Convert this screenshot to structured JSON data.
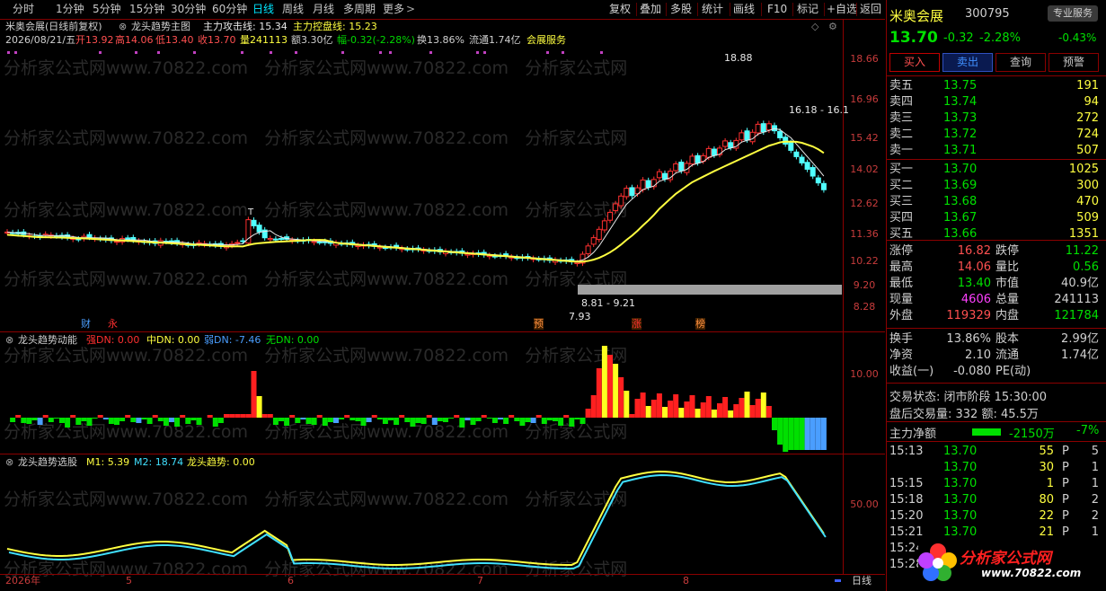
{
  "toolbar": {
    "periods": [
      "分时",
      "1分钟",
      "5分钟",
      "15分钟",
      "30分钟",
      "60分钟",
      "日线",
      "周线",
      "月线",
      "多周期",
      "更多"
    ],
    "right": [
      "复权",
      "叠加",
      "多股",
      "统计",
      "画线",
      "F10",
      "标记",
      "+自选",
      "返回"
    ]
  },
  "main": {
    "stock_line": "米奥会展(日线前复权)",
    "indicator_name": "龙头趋势主图",
    "attack_label": "主力攻击线: 15.34",
    "control_label": "主力控盘线: 15.23",
    "date": "2026/08/21/五",
    "open": "开13.92",
    "high": "高14.06",
    "low": "低13.40",
    "close": "收13.70",
    "vol": "量241113",
    "amount": "额3.30亿",
    "change": "幅-0.32(-2.28%)",
    "turnover": "换13.86%",
    "float": "流通1.74亿",
    "sector": "会展服务",
    "axis": [
      "18.66",
      "16.96",
      "15.42",
      "14.02",
      "12.62",
      "11.36",
      "10.22",
      "9.20",
      "8.28"
    ],
    "ann_high": "18.88",
    "ann_right": "16.18 - 16.1",
    "ann_low": "7.93",
    "ann_range": "8.81 - 9.21",
    "ann_t": "T",
    "markers": [
      "财",
      "永",
      "预",
      "涨",
      "榜"
    ]
  },
  "momentum": {
    "title": "龙头趋势动能",
    "strong": "强DN: 0.00",
    "mid": "中DN: 0.00",
    "weak": "弱DN: -7.46",
    "none": "无DN: 0.00",
    "axis": "10.00"
  },
  "selector": {
    "title": "龙头趋势选股",
    "m1": "M1: 5.39",
    "m2": "M2: 18.74",
    "trend": "龙头趋势: 0.00",
    "axis": "50.00"
  },
  "xaxis": {
    "year": "2026年",
    "months": [
      "5",
      "6",
      "7",
      "8"
    ],
    "period": "日线"
  },
  "quote": {
    "name": "米奥会展",
    "code": "300795",
    "tag": "专业服务",
    "price": "13.70",
    "chg": "-0.32",
    "pct": "-2.28%",
    "extra": "-0.43%",
    "buttons": [
      "买入",
      "卖出",
      "查询",
      "预警"
    ],
    "sells": [
      {
        "label": "卖五",
        "price": "13.75",
        "vol": "191"
      },
      {
        "label": "卖四",
        "price": "13.74",
        "vol": "94"
      },
      {
        "label": "卖三",
        "price": "13.73",
        "vol": "272"
      },
      {
        "label": "卖二",
        "price": "13.72",
        "vol": "724"
      },
      {
        "label": "卖一",
        "price": "13.71",
        "vol": "507"
      }
    ],
    "buys": [
      {
        "label": "买一",
        "price": "13.70",
        "vol": "1025"
      },
      {
        "label": "买二",
        "price": "13.69",
        "vol": "300"
      },
      {
        "label": "买三",
        "price": "13.68",
        "vol": "470"
      },
      {
        "label": "买四",
        "price": "13.67",
        "vol": "509"
      },
      {
        "label": "买五",
        "price": "13.66",
        "vol": "1351"
      }
    ],
    "stats": [
      {
        "l1": "涨停",
        "v1": "16.82",
        "l2": "跌停",
        "v2": "11.22"
      },
      {
        "l1": "最高",
        "v1": "14.06",
        "l2": "量比",
        "v2": "0.56"
      },
      {
        "l1": "最低",
        "v1": "13.40",
        "l2": "市值",
        "v2": "40.9亿"
      },
      {
        "l1": "现量",
        "v1": "4606",
        "l2": "总量",
        "v2": "241113"
      },
      {
        "l1": "外盘",
        "v1": "119329",
        "l2": "内盘",
        "v2": "121784"
      }
    ],
    "stats2": [
      {
        "l1": "换手",
        "v1": "13.86%",
        "l2": "股本",
        "v2": "2.99亿"
      },
      {
        "l1": "净资",
        "v1": "2.10",
        "l2": "流通",
        "v2": "1.74亿"
      },
      {
        "l1": "收益(一)",
        "v1": "-0.080",
        "l2": "PE(动)",
        "v2": ""
      }
    ],
    "trade_status": "交易状态: 闭市阶段 15:30:00",
    "after_hours": "盘后交易量: 332  额: 45.5万",
    "net_label": "主力净额",
    "net_value": "-2150万",
    "net_pct": "-7%",
    "ticks": [
      {
        "t": "15:13",
        "p": "13.70",
        "v": "55",
        "s": "P",
        "n": "5"
      },
      {
        "t": "",
        "p": "13.70",
        "v": "30",
        "s": "P",
        "n": "1"
      },
      {
        "t": "15:15",
        "p": "13.70",
        "v": "1",
        "s": "P",
        "n": "1"
      },
      {
        "t": "15:18",
        "p": "13.70",
        "v": "80",
        "s": "P",
        "n": "2"
      },
      {
        "t": "15:20",
        "p": "13.70",
        "v": "22",
        "s": "P",
        "n": "2"
      },
      {
        "t": "15:21",
        "p": "13.70",
        "v": "21",
        "s": "P",
        "n": "1"
      },
      {
        "t": "15:24",
        "p": "",
        "v": "",
        "s": "",
        "n": ""
      },
      {
        "t": "15:28",
        "p": "",
        "v": "",
        "s": "",
        "n": ""
      }
    ],
    "logo": "分析家公式网",
    "logo_url": "www.70822.com"
  },
  "watermark": "分析家公式网www.70822.com"
}
